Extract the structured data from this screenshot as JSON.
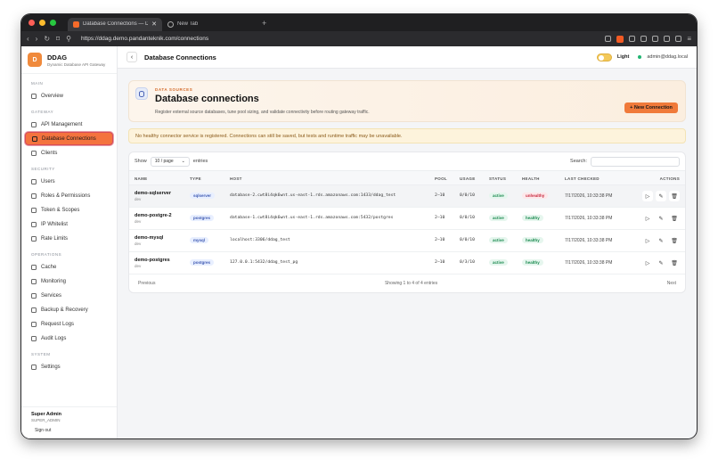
{
  "browser": {
    "tabs": [
      {
        "title": "Database Connections — DDA",
        "active": true
      },
      {
        "title": "New Tab",
        "active": false
      }
    ],
    "url": "https://ddag.demo.pandanteknik.com/connections"
  },
  "brand": {
    "logo_letter": "D",
    "name": "DDAG",
    "subtitle": "Dynamic Database API Gateway"
  },
  "sidebar": {
    "sections": [
      {
        "label": "MAIN",
        "items": [
          {
            "label": "Overview",
            "icon": "grid-icon"
          }
        ]
      },
      {
        "label": "GATEWAY",
        "items": [
          {
            "label": "API Management",
            "icon": "link-icon"
          },
          {
            "label": "Database Connections",
            "icon": "database-icon",
            "active": true
          },
          {
            "label": "Clients",
            "icon": "users-icon"
          }
        ]
      },
      {
        "label": "SECURITY",
        "items": [
          {
            "label": "Users",
            "icon": "user-icon"
          },
          {
            "label": "Roles & Permissions",
            "icon": "shield-icon"
          },
          {
            "label": "Token & Scopes",
            "icon": "star-icon"
          },
          {
            "label": "IP Whitelist",
            "icon": "globe-icon"
          },
          {
            "label": "Rate Limits",
            "icon": "gauge-icon"
          }
        ]
      },
      {
        "label": "OPERATIONS",
        "items": [
          {
            "label": "Cache",
            "icon": "zap-icon"
          },
          {
            "label": "Monitoring",
            "icon": "activity-icon"
          },
          {
            "label": "Services",
            "icon": "server-icon"
          },
          {
            "label": "Backup & Recovery",
            "icon": "archive-icon"
          },
          {
            "label": "Request Logs",
            "icon": "file-icon"
          },
          {
            "label": "Audit Logs",
            "icon": "check-square-icon"
          }
        ]
      },
      {
        "label": "SYSTEM",
        "items": [
          {
            "label": "Settings",
            "icon": "gear-icon"
          }
        ]
      }
    ]
  },
  "user": {
    "name": "Super Admin",
    "role": "SUPER_ADMIN",
    "signout": "Sign out"
  },
  "topbar": {
    "title": "Database Connections",
    "theme_label": "Light",
    "email": "admin@ddag.local"
  },
  "hero": {
    "kicker": "DATA SOURCES",
    "title": "Database connections",
    "description": "Register external source databases, tune pool sizing, and validate connectivity before routing gateway traffic.",
    "new_button": "+ New Connection"
  },
  "alert": "No healthy connector service is registered. Connections can still be saved, but tests and runtime traffic may be unavailable.",
  "table_controls": {
    "show_label": "Show",
    "page_size": "10 / page",
    "entries_label": "entries",
    "search_label": "Search:"
  },
  "columns": [
    "NAME",
    "TYPE",
    "HOST",
    "POOL",
    "USAGE",
    "STATUS",
    "HEALTH",
    "LAST CHECKED",
    "ACTIONS"
  ],
  "rows": [
    {
      "name": "demo-sqlserver",
      "env": "dev",
      "type": "sqlserver",
      "host": "database-2.cwt8i4qk6wnt.us-east-1.rds.amazonaws.com:1433/ddag_test",
      "pool": "2–10",
      "usage": "0/0/10",
      "status": "active",
      "health": "unhealthy",
      "checked": "7/17/2026, 10:33:38 PM"
    },
    {
      "name": "demo-postgre-2",
      "env": "dev",
      "type": "postgres",
      "host": "database-1.cwt8i4qk6wnt.us-east-1.rds.amazonaws.com:5432/postgres",
      "pool": "2–10",
      "usage": "0/0/10",
      "status": "active",
      "health": "healthy",
      "checked": "7/17/2026, 10:33:38 PM"
    },
    {
      "name": "demo-mysql",
      "env": "dev",
      "type": "mysql",
      "host": "localhost:3306/ddag_test",
      "pool": "2–10",
      "usage": "0/0/10",
      "status": "active",
      "health": "healthy",
      "checked": "7/17/2026, 10:33:38 PM"
    },
    {
      "name": "demo-postgres",
      "env": "dev",
      "type": "postgres",
      "host": "127.0.0.1:5432/ddag_test_pg",
      "pool": "2–10",
      "usage": "0/3/10",
      "status": "active",
      "health": "healthy",
      "checked": "7/17/2026, 10:33:38 PM"
    }
  ],
  "pagination": {
    "previous": "Previous",
    "summary": "Showing 1 to 4 of 4 entries",
    "next": "Next"
  },
  "colors": {
    "accent": "#f07a3a",
    "healthy": "#1a8a4f",
    "unhealthy": "#c6283e"
  }
}
